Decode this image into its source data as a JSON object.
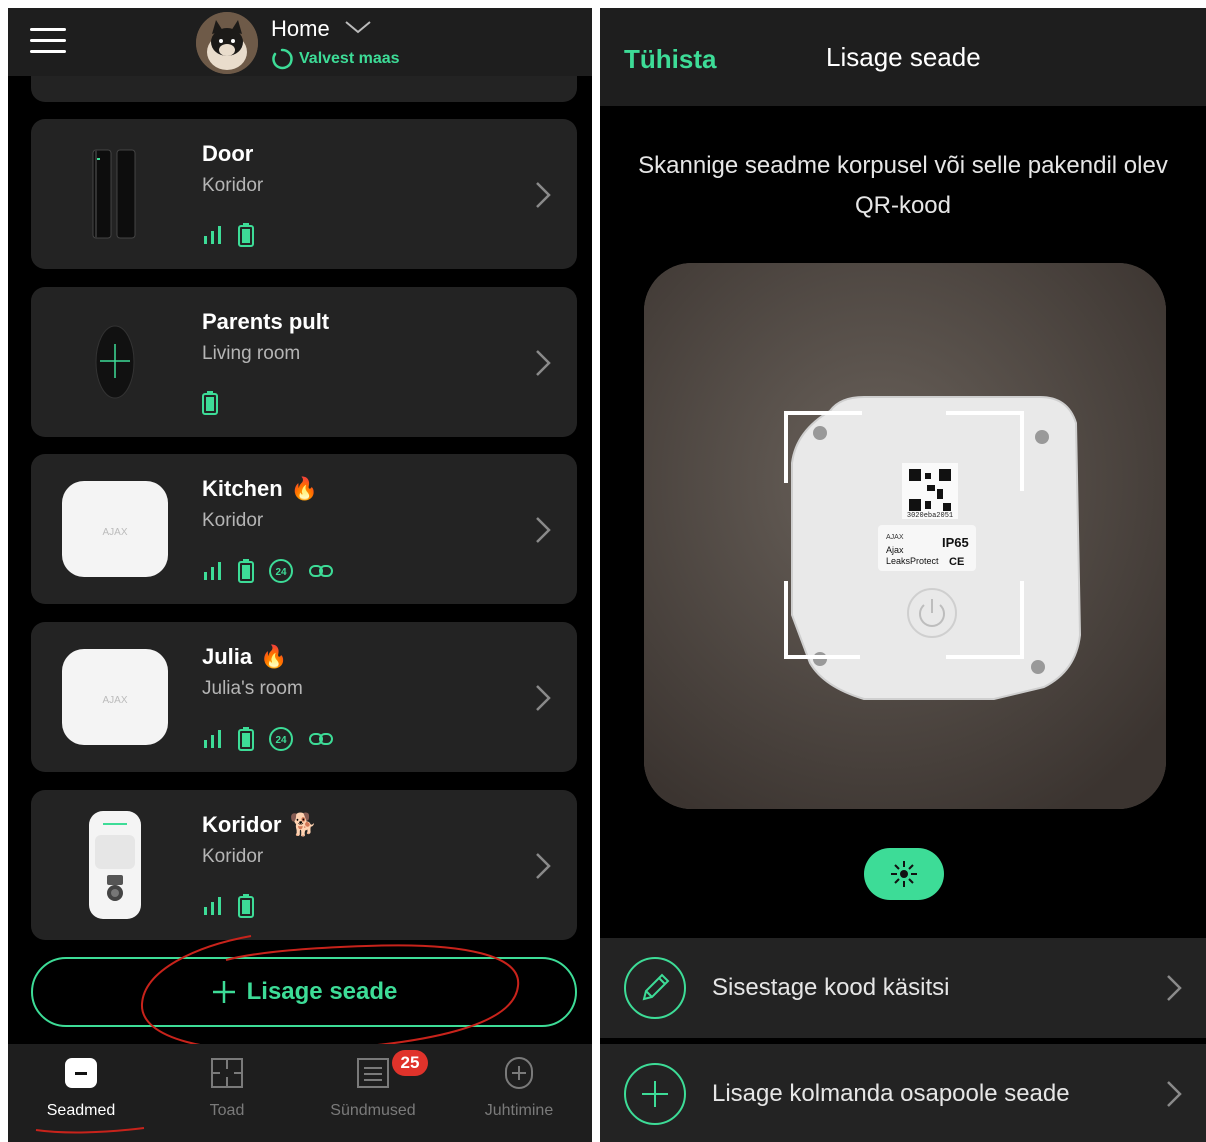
{
  "left": {
    "header": {
      "hub_name": "Home",
      "status": "Valvest maas"
    },
    "devices": [
      {
        "name": "Door",
        "room": "Koridor",
        "emoji": "",
        "thumb": "door-sensor"
      },
      {
        "name": "Parents pult",
        "room": "Living room",
        "emoji": "",
        "thumb": "key-fob"
      },
      {
        "name": "Kitchen",
        "room": "Koridor",
        "emoji": "🔥",
        "thumb": "fire-protect",
        "brand": "AJAX",
        "badge24": "24"
      },
      {
        "name": "Julia",
        "room": "Julia's room",
        "emoji": "🔥",
        "thumb": "fire-protect",
        "brand": "AJAX",
        "badge24": "24"
      },
      {
        "name": "Koridor",
        "room": "Koridor",
        "emoji": "🐕",
        "thumb": "motion-cam"
      }
    ],
    "add_button": {
      "label": "Lisage seade"
    },
    "tabs": [
      {
        "label": "Seadmed",
        "icon": "devices-icon",
        "active": true
      },
      {
        "label": "Toad",
        "icon": "rooms-icon"
      },
      {
        "label": "Sündmused",
        "icon": "events-icon",
        "badge": "25"
      },
      {
        "label": "Juhtimine",
        "icon": "control-icon"
      }
    ]
  },
  "right": {
    "cancel_label": "Tühista",
    "title": "Lisage seade",
    "instruction": "Skannige seadme korpusel või selle pakendil olev QR-kood",
    "device_label": {
      "serial": "3020eba2051",
      "brand": "AJAX",
      "rating": "IP65",
      "line1": "Ajax",
      "line2": "LeaksProtect",
      "marks": "CE"
    },
    "options": [
      {
        "label": "Sisestage kood käsitsi",
        "icon": "pencil-icon"
      },
      {
        "label": "Lisage kolmanda osapoole seade",
        "icon": "plus-icon"
      }
    ]
  },
  "colors": {
    "accent": "#3ddc97",
    "card": "#232323",
    "bar": "#1e1e1e",
    "badge": "#e0332b",
    "annotation": "#c8231b"
  }
}
